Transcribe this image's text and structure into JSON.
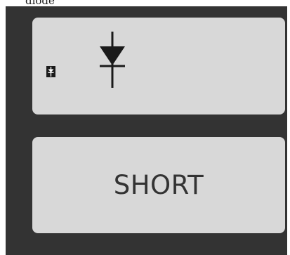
{
  "title": "diode",
  "buttons": {
    "diode": {
      "icon": "diode-symbol-icon",
      "badge_icon": "diode-badge-icon"
    },
    "short": {
      "label": "SHORT"
    }
  },
  "colors": {
    "panel_bg": "#333333",
    "tile_bg": "#d8d8d8",
    "icon_color": "#1a1a1a",
    "text_color": "#333333"
  }
}
